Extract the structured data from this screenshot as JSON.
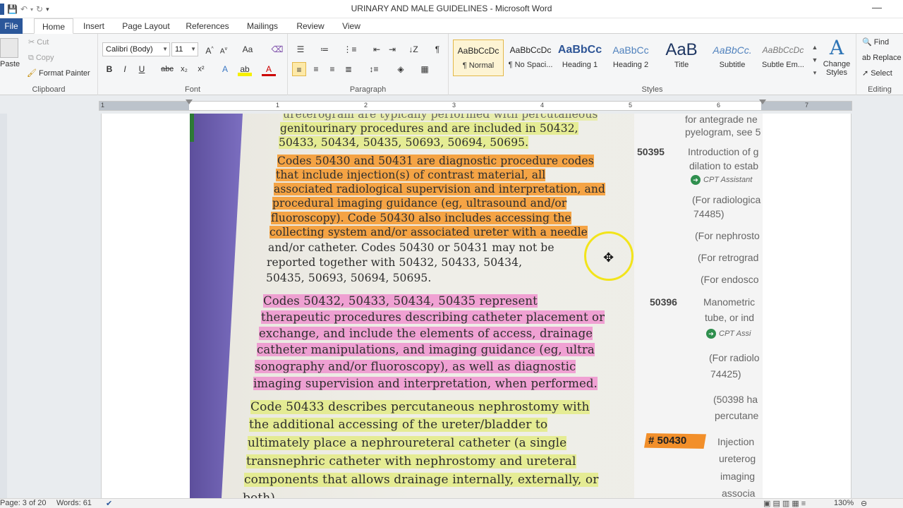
{
  "window": {
    "title": "URINARY AND MALE GUIDELINES  -  Microsoft Word",
    "minimize": "—"
  },
  "qat": {
    "save_icon": "save-icon",
    "undo_icon": "undo-icon",
    "redo_icon": "redo-icon"
  },
  "tabs": {
    "file": "File",
    "home": "Home",
    "insert": "Insert",
    "page_layout": "Page Layout",
    "references": "References",
    "mailings": "Mailings",
    "review": "Review",
    "view": "View"
  },
  "clipboard": {
    "paste": "Paste",
    "cut": "Cut",
    "copy": "Copy",
    "format_painter": "Format Painter",
    "label": "Clipboard"
  },
  "font": {
    "name": "Calibri (Body)",
    "size": "11",
    "label": "Font"
  },
  "paragraph": {
    "label": "Paragraph"
  },
  "styles": {
    "label": "Styles",
    "items": [
      {
        "sample": "AaBbCcDc",
        "name": "¶ Normal"
      },
      {
        "sample": "AaBbCcDc",
        "name": "¶ No Spaci..."
      },
      {
        "sample": "AaBbCc",
        "name": "Heading 1"
      },
      {
        "sample": "AaBbCc",
        "name": "Heading 2"
      },
      {
        "sample": "AaB",
        "name": "Title"
      },
      {
        "sample": "AaBbCc.",
        "name": "Subtitle"
      },
      {
        "sample": "AaBbCcDc",
        "name": "Subtle Em..."
      }
    ],
    "change_styles": "Change Styles"
  },
  "editing": {
    "find": "Find",
    "replace": "Replace",
    "select": "Select",
    "label": "Editing"
  },
  "ruler": {
    "numbers": [
      "1",
      "1",
      "2",
      "3",
      "4",
      "5",
      "6",
      "7"
    ]
  },
  "document": {
    "lines_top": [
      "ureterogram are typically performed with percutaneous",
      "genitourinary procedures and are included in 50432,",
      "50433, 50434, 50435, 50693, 50694, 50695."
    ],
    "para1": [
      "Codes 50430 and 50431 are diagnostic procedure codes",
      "that include injection(s) of contrast material, all",
      "associated radiological supervision and interpretation, and",
      "procedural imaging guidance (eg, ultrasound and/or",
      "fluoroscopy). Code 50430 also includes accessing the",
      "collecting system and/or associated ureter with a needle",
      "and/or catheter. Codes 50430 or 50431 may not be",
      "reported together with 50432, 50433, 50434,",
      "50435, 50693, 50694, 50695."
    ],
    "para2": [
      "Codes 50432, 50433, 50434, 50435 represent",
      "therapeutic procedures describing catheter placement or",
      "exchange, and include the elements of access, drainage",
      "catheter manipulations, and imaging guidance (eg, ultra",
      "sonography and/or fluoroscopy), as well as diagnostic",
      "imaging supervision and interpretation, when performed."
    ],
    "para3": [
      "Code 50433 describes percutaneous nephrostomy with",
      "the additional accessing of the ureter/bladder to",
      "ultimately place a nephroureteral catheter (a single",
      "transnephric catheter with nephrostomy and ureteral",
      "components that allows drainage internally, externally, or",
      "both)."
    ],
    "right": {
      "r1": "for antegrade ne",
      "r2": "pyelogram, see 5",
      "code1": "50395",
      "r3": "Introduction of g",
      "r4": "dilation to estab",
      "cpt1": "CPT Assistant",
      "r5": "(For radiologica",
      "r6": "74485)",
      "r7": "(For nephrosto",
      "r8": "(For retrograd",
      "r9": "(For endosco",
      "code2": "50396",
      "r10": "Manometric",
      "r11": "tube, or ind",
      "cpt2": "CPT Assi",
      "r12": "(For radiolo",
      "r13": "74425)",
      "r14": "(50398 ha",
      "r15": "percutane",
      "code3": "# 50430",
      "r16": "Injection",
      "r17": "ureterog",
      "r18": "imaging",
      "r19": "associa"
    }
  },
  "status": {
    "page": "Page: 3 of 20",
    "words": "Words: 61",
    "zoom": "130%"
  }
}
